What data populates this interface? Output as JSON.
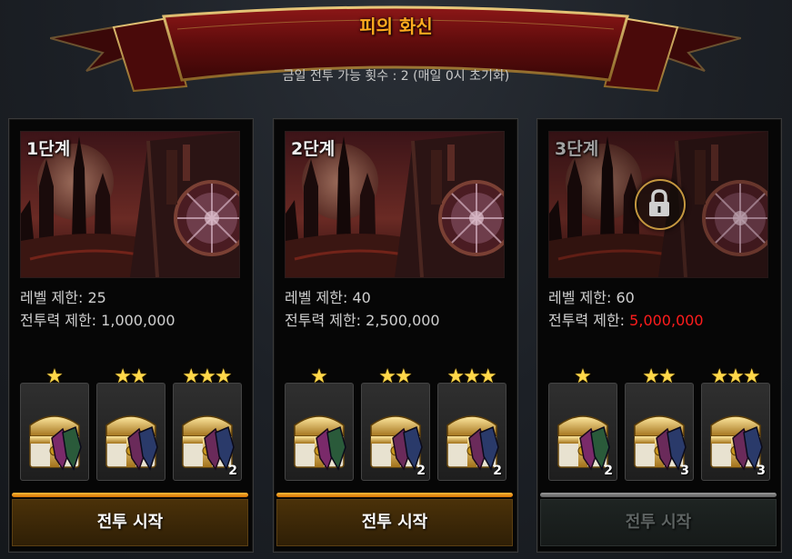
{
  "header": {
    "title": "피의 화신",
    "subtitle": "금일 전투 가능 횟수 : 2 (매일 0시 초기화)"
  },
  "stages": [
    {
      "label": "1단계",
      "level_req": "레벨 제한: 25",
      "power_label": "전투력 제한: ",
      "power_value": "1,000,000",
      "locked": false,
      "rewards": [
        {
          "stars": "★",
          "count": ""
        },
        {
          "stars": "★★",
          "count": ""
        },
        {
          "stars": "★★★",
          "count": "2"
        }
      ],
      "button": "전투 시작"
    },
    {
      "label": "2단계",
      "level_req": "레벨 제한: 40",
      "power_label": "전투력 제한: ",
      "power_value": "2,500,000",
      "locked": false,
      "rewards": [
        {
          "stars": "★",
          "count": ""
        },
        {
          "stars": "★★",
          "count": "2"
        },
        {
          "stars": "★★★",
          "count": "2"
        }
      ],
      "button": "전투 시작"
    },
    {
      "label": "3단계",
      "level_req": "레벨 제한: 60",
      "power_label": "전투력 제한: ",
      "power_value": "5,000,000",
      "locked": true,
      "rewards": [
        {
          "stars": "★",
          "count": "2"
        },
        {
          "stars": "★★",
          "count": "3"
        },
        {
          "stars": "★★★",
          "count": "3"
        }
      ],
      "button": "전투 시작"
    }
  ],
  "icons": {
    "lock": "lock-icon",
    "reward": "treasure-chest-icon",
    "star": "star-icon"
  },
  "colors": {
    "title": "#ffab1f",
    "power_insufficient": "#ff1c1c",
    "active_bar": "#f2a11c"
  }
}
